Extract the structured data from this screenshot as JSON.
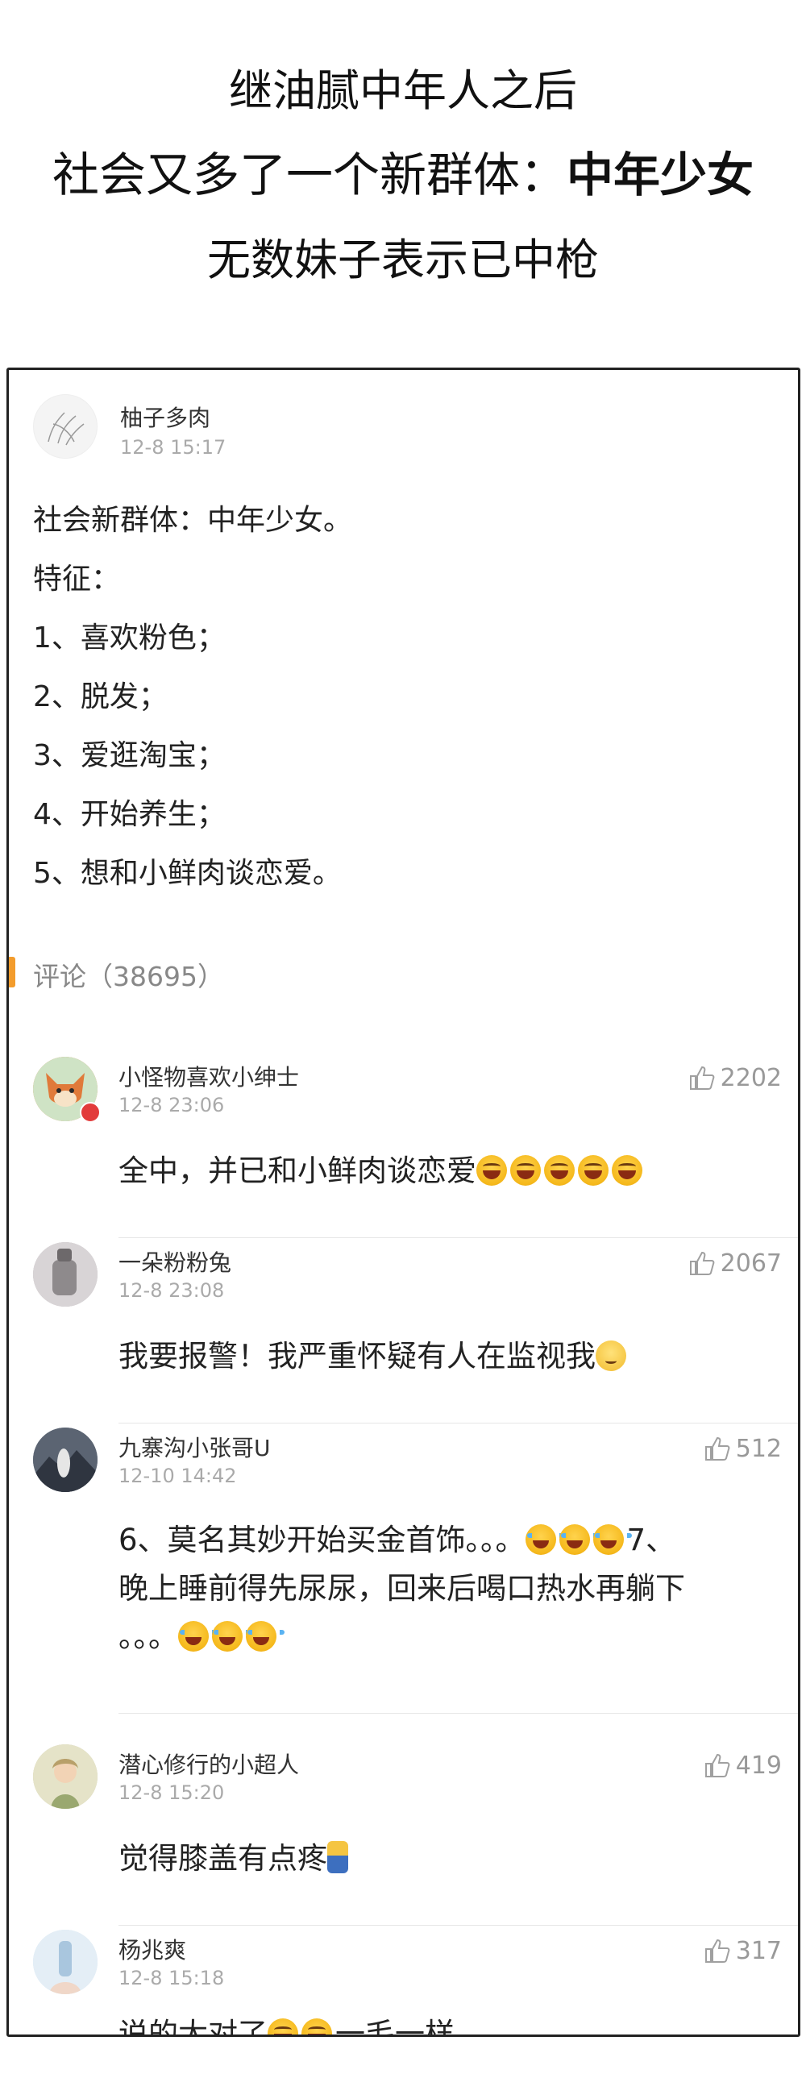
{
  "headline": {
    "line1": "继油腻中年人之后",
    "line2_prefix": "社会又多了一个新群体：",
    "line2_bold": "中年少女",
    "line3": "无数妹子表示已中枪"
  },
  "post": {
    "author": "柚子多肉",
    "date": "12-8 15:17",
    "lines": [
      "社会新群体：中年少女。",
      "特征：",
      "1、喜欢粉色；",
      "2、脱发；",
      "3、爱逛淘宝；",
      "4、开始养生；",
      "5、想和小鲜肉谈恋爱。"
    ]
  },
  "comments_header": "评论（38695）",
  "comments": [
    {
      "author": "小怪物喜欢小绅士",
      "date": "12-8 23:06",
      "likes": "2202",
      "text_lines": [
        "全中，并已和小鲜肉谈恋爱"
      ],
      "emojis": [
        "laugh-emoji",
        "laugh-emoji",
        "laugh-emoji",
        "laugh-emoji",
        "laugh-emoji"
      ],
      "avatar_color": "#e0864a"
    },
    {
      "author": "一朵粉粉兔",
      "date": "12-8 23:08",
      "likes": "2067",
      "text_lines": [
        "我要报警！我严重怀疑有人在监视我"
      ],
      "emojis": [
        "wink-emoji"
      ],
      "avatar_color": "#b7b2b4"
    },
    {
      "author": "九寨沟小张哥U",
      "date": "12-10 14:42",
      "likes": "512",
      "text_lines": [
        "6、莫名其妙开始买金首饰。。。",
        "7、",
        "晚上睡前得先尿尿，回来后喝口热水再躺下",
        "。。。"
      ],
      "emojis": [
        "cry-laugh-emoji"
      ],
      "avatar_color": "#7d8794"
    },
    {
      "author": "潜心修行的小超人",
      "date": "12-8 15:20",
      "likes": "419",
      "text_lines": [
        "觉得膝盖有点疼"
      ],
      "emojis": [
        "kneel-emoji"
      ],
      "avatar_color": "#c9c6a0"
    },
    {
      "author": "杨兆爽",
      "date": "12-8 15:18",
      "likes": "317",
      "text_lines": [
        "说的太对了",
        "一毛一样"
      ],
      "emojis": [
        "laugh-emoji"
      ],
      "avatar_color": "#cfe1ef"
    }
  ]
}
